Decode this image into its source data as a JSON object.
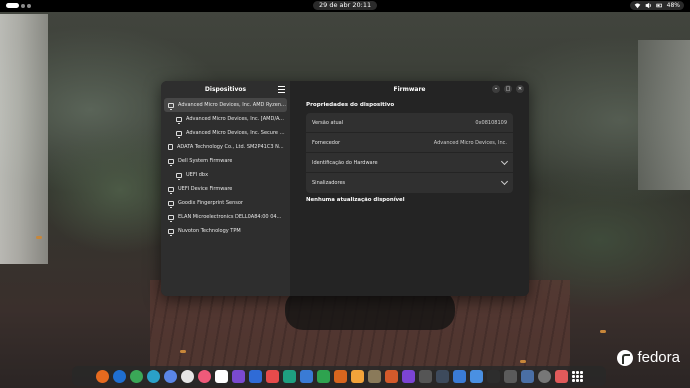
{
  "topbar": {
    "clock": "29 de abr  20:11",
    "battery": "48%"
  },
  "window": {
    "sidebar_title": "Dispositivos",
    "title": "Firmware",
    "devices": [
      {
        "label": "Advanced Micro Devices, Inc. AMD Ryzen ...",
        "level": 0,
        "icon": "monitor-icon",
        "selected": true
      },
      {
        "label": "Advanced Micro Devices, Inc. [AMD/ATI...",
        "level": 1,
        "icon": "monitor-icon"
      },
      {
        "label": "Advanced Micro Devices, Inc. Secure Pr...",
        "level": 1,
        "icon": "monitor-icon"
      },
      {
        "label": "ADATA Technology Co., Ltd. SM2P41C3 N...",
        "level": 0,
        "icon": "chip-icon"
      },
      {
        "label": "Dell System Firmware",
        "level": 0,
        "icon": "monitor-icon"
      },
      {
        "label": "UEFI dbx",
        "level": 1,
        "icon": "monitor-icon"
      },
      {
        "label": "UEFI Device Firmware",
        "level": 0,
        "icon": "monitor-icon"
      },
      {
        "label": "Goodix Fingerprint Sensor",
        "level": 0,
        "icon": "monitor-icon"
      },
      {
        "label": "ELAN Microelectronics DELL0A84:00 04...",
        "level": 0,
        "icon": "monitor-icon"
      },
      {
        "label": "Nuvoton Technology TPM",
        "level": 0,
        "icon": "monitor-icon"
      }
    ],
    "properties_title": "Propriedades do dispositivo",
    "properties": {
      "current_version_label": "Versão atual",
      "current_version_value": "0x08108109",
      "vendor_label": "Fornecedor",
      "vendor_value": "Advanced Micro Devices, Inc.",
      "hardware_id_label": "Identificação do Hardware",
      "flags_label": "Sinalizadores"
    },
    "no_update": "Nenhuma atualização disponível"
  },
  "wallpaper": {
    "brand": "fedora"
  },
  "dock": {
    "apps": [
      {
        "name": "firefox-icon",
        "color": "#e66a1f",
        "round": true
      },
      {
        "name": "thunderbird-icon",
        "color": "#1f6fd1",
        "round": true
      },
      {
        "name": "chrome-icon",
        "color": "#3aa757",
        "round": true
      },
      {
        "name": "edge-icon",
        "color": "#2aa0c8",
        "round": true
      },
      {
        "name": "chromium-icon",
        "color": "#5a86e6",
        "round": true
      },
      {
        "name": "vivaldi-icon",
        "color": "#e5e5e5",
        "round": true
      },
      {
        "name": "settings-app-icon",
        "color": "#ef5a7a",
        "round": true
      },
      {
        "name": "calendar-icon",
        "color": "#ffffff",
        "round": false
      },
      {
        "name": "video-icon",
        "color": "#7a4ad0",
        "round": false
      },
      {
        "name": "photos-icon",
        "color": "#2f6bd6",
        "round": false
      },
      {
        "name": "appstore-icon",
        "color": "#e64b4b",
        "round": false
      },
      {
        "name": "drawing-icon",
        "color": "#1ea080",
        "round": false
      },
      {
        "name": "docs-icon",
        "color": "#3a7bd5",
        "round": false
      },
      {
        "name": "sheets-icon",
        "color": "#2ea34f",
        "round": false
      },
      {
        "name": "impress-icon",
        "color": "#d8651e",
        "round": false
      },
      {
        "name": "layers-icon",
        "color": "#f2a33a",
        "round": false
      },
      {
        "name": "gimp-icon",
        "color": "#8a7a5a",
        "round": false
      },
      {
        "name": "image-viewer-icon",
        "color": "#d35a2b",
        "round": false
      },
      {
        "name": "obsidian-icon",
        "color": "#7b44d3",
        "round": false
      },
      {
        "name": "heart-icon",
        "color": "#555555",
        "round": false
      },
      {
        "name": "monitor-app-icon",
        "color": "#3d4a5c",
        "round": false
      },
      {
        "name": "extensions-icon",
        "color": "#3a7bd5",
        "round": false
      },
      {
        "name": "tweaks-icon",
        "color": "#4a90e2",
        "round": false
      },
      {
        "name": "terminal-icon",
        "color": "#2d2d2d",
        "round": false
      },
      {
        "name": "screenshot-icon",
        "color": "#5a5a5a",
        "round": false
      },
      {
        "name": "files-icon",
        "color": "#4a6fa5",
        "round": false
      },
      {
        "name": "settings-icon",
        "color": "#777777",
        "round": true
      },
      {
        "name": "music-icon",
        "color": "#e05a5a",
        "round": false
      }
    ]
  }
}
